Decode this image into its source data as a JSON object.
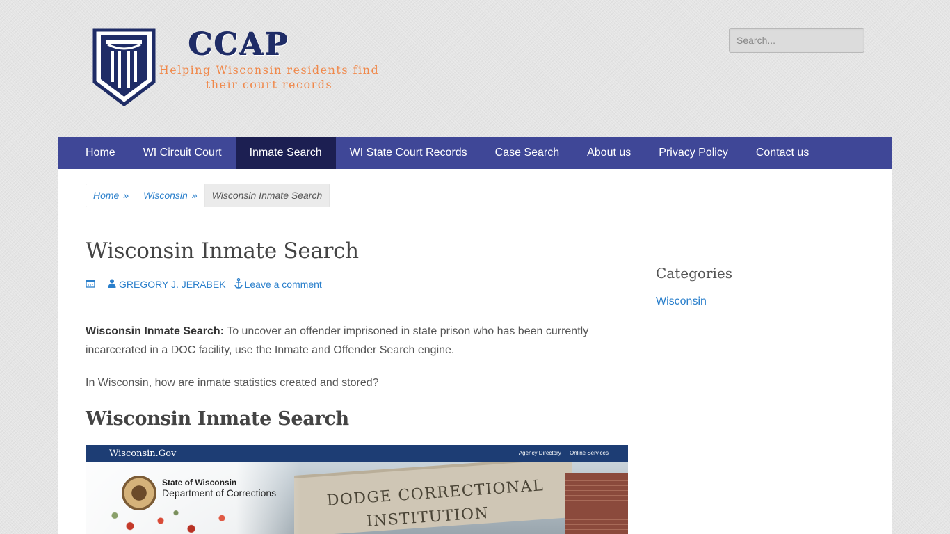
{
  "site": {
    "name": "CCAP",
    "tagline_line1": "Helping Wisconsin residents find",
    "tagline_line2": "their court records"
  },
  "search": {
    "placeholder": "Search..."
  },
  "nav": {
    "items": [
      {
        "label": "Home"
      },
      {
        "label": "WI Circuit Court"
      },
      {
        "label": "Inmate Search"
      },
      {
        "label": "WI State Court Records"
      },
      {
        "label": "Case Search"
      },
      {
        "label": "About us"
      },
      {
        "label": "Privacy Policy"
      },
      {
        "label": "Contact us"
      }
    ],
    "active": "Inmate Search"
  },
  "breadcrumb": {
    "items": [
      {
        "label": "Home",
        "sep": "»"
      },
      {
        "label": "Wisconsin",
        "sep": "»"
      }
    ],
    "current": "Wisconsin Inmate Search"
  },
  "article": {
    "title": "Wisconsin Inmate Search",
    "author": "GREGORY J. JERABEK",
    "comment_link": "Leave a comment",
    "intro_bold": "Wisconsin Inmate Search:",
    "intro_text": " To uncover an offender imprisoned in state prison who has been currently incarcerated in a DOC facility, use the Inmate and Offender Search engine.",
    "question": "In Wisconsin, how are inmate statistics created and stored?",
    "subheading": "Wisconsin Inmate Search",
    "image": {
      "gov_label": "Wisconsin.Gov",
      "links": [
        "Agency Directory",
        "Online Services"
      ],
      "state_label": "State of Wisconsin",
      "dept_label": "Department of Corrections",
      "sign_line1": "DODGE CORRECTIONAL",
      "sign_line2": "INSTITUTION"
    }
  },
  "sidebar": {
    "title": "Categories",
    "links": [
      {
        "label": "Wisconsin"
      }
    ]
  },
  "colors": {
    "nav_bg": "#3f4797",
    "nav_active_bg": "#1c1f52",
    "link": "#2a7fcb",
    "brand": "#1f2c66",
    "tagline": "#f0884a"
  },
  "icons": {
    "logo": "pillar-shield-icon",
    "date": "calendar-icon",
    "author": "user-icon",
    "comment": "anchor-icon"
  }
}
